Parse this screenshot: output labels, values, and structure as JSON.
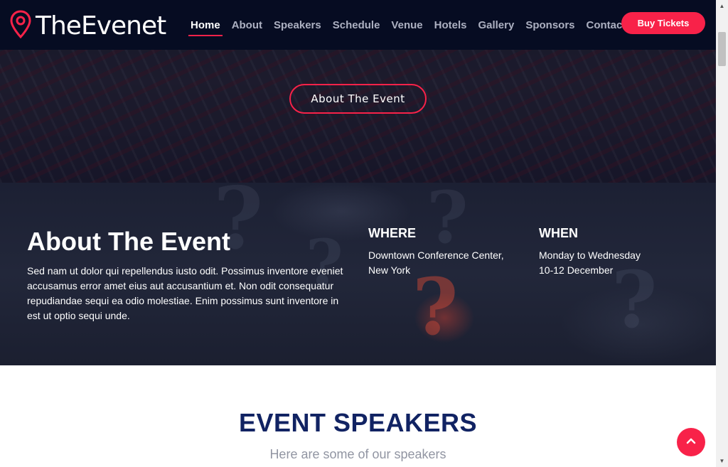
{
  "header": {
    "logo_text": "TheEvenet",
    "nav": [
      {
        "label": "Home",
        "active": true
      },
      {
        "label": "About"
      },
      {
        "label": "Speakers"
      },
      {
        "label": "Schedule"
      },
      {
        "label": "Venue"
      },
      {
        "label": "Hotels"
      },
      {
        "label": "Gallery"
      },
      {
        "label": "Sponsors"
      },
      {
        "label": "Contact"
      }
    ],
    "buy_label": "Buy Tickets"
  },
  "hero": {
    "button_label": "About The Event"
  },
  "about": {
    "title": "About The Event",
    "text": "Sed nam ut dolor qui repellendus iusto odit. Possimus inventore eveniet accusamus error amet eius aut accusantium et. Non odit consequatur repudiandae sequi ea odio molestiae. Enim possimus sunt inventore in est ut optio sequi unde.",
    "where": {
      "heading": "WHERE",
      "line1": "Downtown Conference Center,",
      "line2": "New York"
    },
    "when": {
      "heading": "WHEN",
      "line1": "Monday to Wednesday",
      "line2": "10-12 December"
    }
  },
  "speakers": {
    "title": "EVENT SPEAKERS",
    "subtitle": "Here are some of our speakers"
  },
  "icons": {
    "logo": "map-pin-icon",
    "back_to_top": "chevron-up-icon"
  },
  "colors": {
    "accent": "#f82249",
    "header_bg": "#060c22",
    "title_navy": "#112363"
  }
}
